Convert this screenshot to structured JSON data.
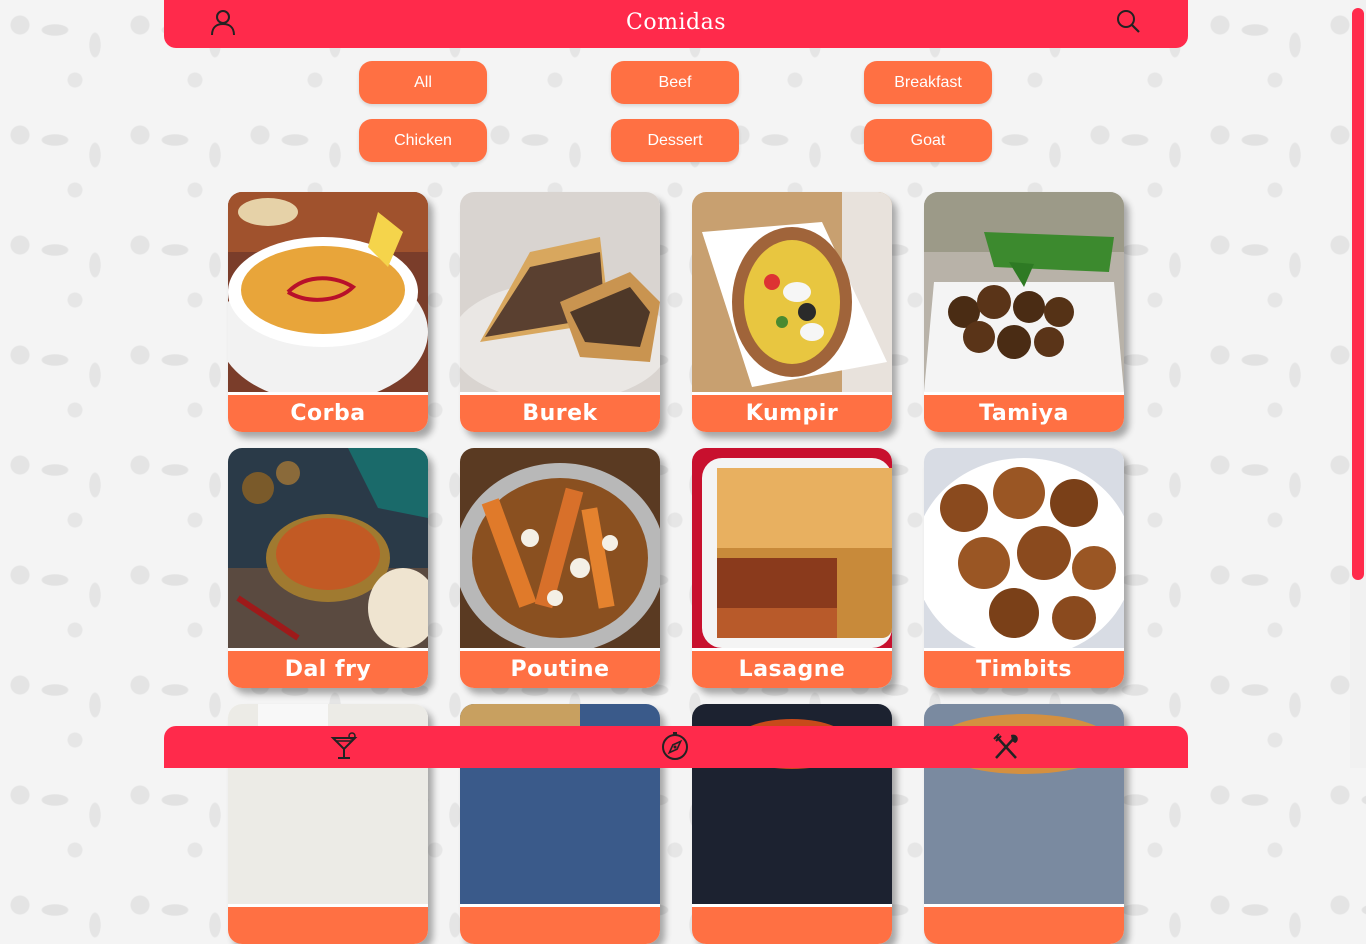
{
  "header": {
    "title": "Comidas",
    "profile_icon": "user-icon",
    "search_icon": "search-icon"
  },
  "filters": [
    "All",
    "Beef",
    "Breakfast",
    "Chicken",
    "Dessert",
    "Goat"
  ],
  "meals": [
    {
      "name": "Corba"
    },
    {
      "name": "Burek"
    },
    {
      "name": "Kumpir"
    },
    {
      "name": "Tamiya"
    },
    {
      "name": "Dal fry"
    },
    {
      "name": "Poutine"
    },
    {
      "name": "Lasagne"
    },
    {
      "name": "Timbits"
    },
    {
      "name": ""
    },
    {
      "name": ""
    },
    {
      "name": ""
    },
    {
      "name": ""
    }
  ],
  "footer": {
    "icons": [
      "cocktail-icon",
      "compass-icon",
      "utensils-icon"
    ]
  },
  "colors": {
    "primary": "#ff2a4b",
    "accent": "#ff7043",
    "background": "#f4f4f4"
  }
}
